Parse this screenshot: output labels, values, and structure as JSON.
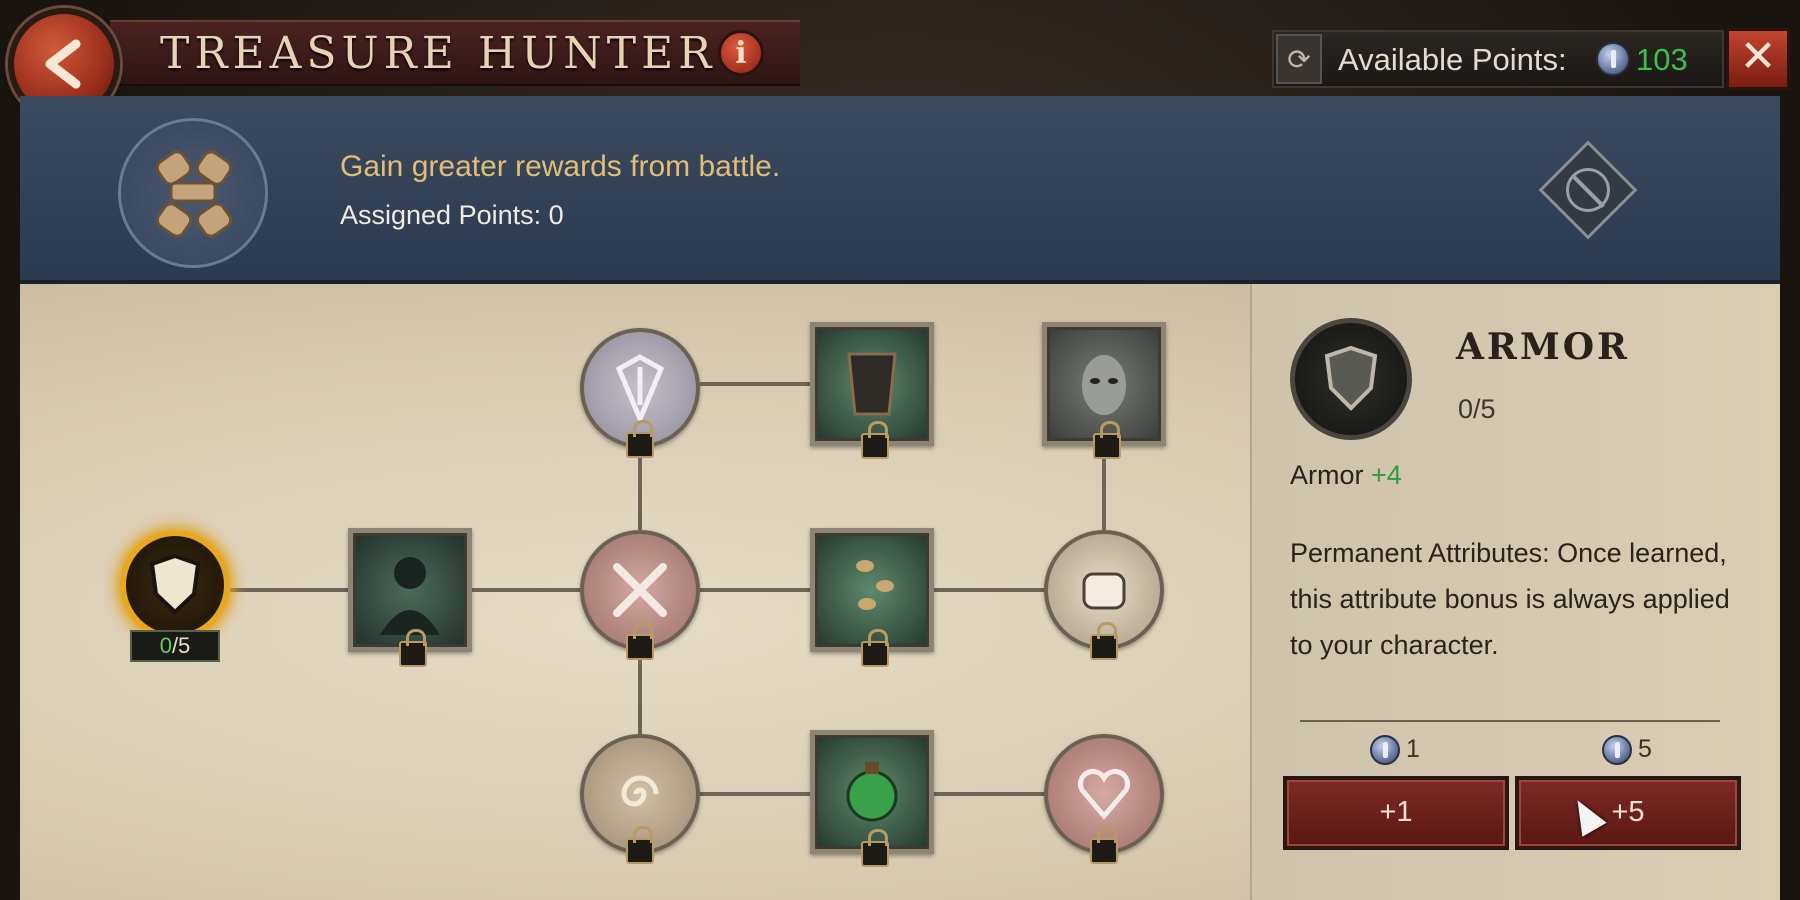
{
  "header": {
    "title": "TREASURE HUNTER",
    "info_label": "i",
    "points_label": "Available Points:",
    "points_value": "103",
    "close_label": "✕"
  },
  "tree": {
    "description": "Gain greater rewards from battle.",
    "assigned_label": "Assigned Points: 0"
  },
  "nodes": {
    "armor": {
      "level": "0/5",
      "current": "0",
      "max": "/5",
      "state": "unlocked"
    },
    "locked_count": 10
  },
  "detail": {
    "name": "ARMOR",
    "level": "0/5",
    "attribute_name": "Armor",
    "attribute_bonus": "+4",
    "description": "Permanent Attributes: Once learned, this attribute bonus is always applied to your character.",
    "cost_1": "1",
    "cost_5": "5",
    "add_1_label": "+1",
    "add_5_label": "+5"
  },
  "colors": {
    "accent_gold": "#e8a81c",
    "points_green": "#39c24a",
    "bonus_green": "#2e9e3a",
    "button_red": "#7e2a24"
  }
}
